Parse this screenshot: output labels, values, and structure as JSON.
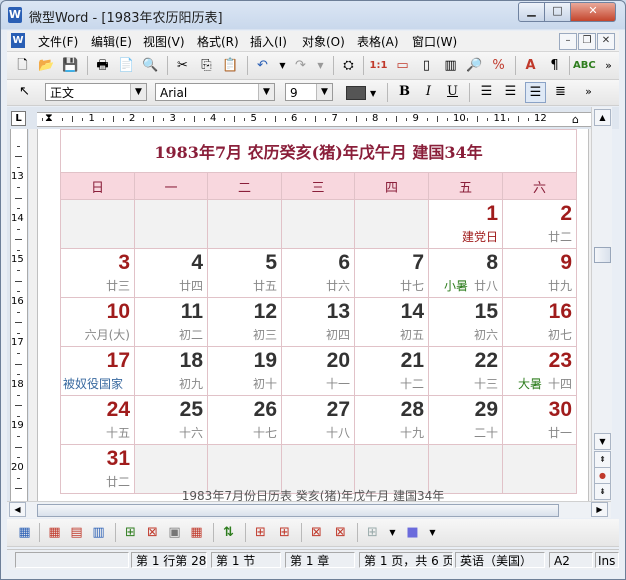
{
  "window": {
    "title": "微型Word - [1983年农历阳历表]",
    "icon_letter": "W",
    "min_label": "▁",
    "max_label": "□",
    "close_label": "✕"
  },
  "menubar": {
    "icon_letter": "W",
    "items": [
      "文件(F)",
      "编辑(E)",
      "视图(V)",
      "格式(R)",
      "插入(I)",
      "对象(O)",
      "表格(A)",
      "窗口(W)"
    ],
    "mdi_min": "–",
    "mdi_restore": "❐",
    "mdi_close": "✕"
  },
  "format_toolbar": {
    "style": "正文",
    "font": "Arial",
    "size": "9",
    "bold": "B",
    "italic": "I",
    "underline": "U"
  },
  "ruler": {
    "corner": "L",
    "numbers": [
      "1",
      "2",
      "3",
      "4",
      "5",
      "6",
      "7",
      "8",
      "9",
      "10",
      "11",
      "12"
    ]
  },
  "vruler": {
    "numbers": [
      "13",
      "14",
      "15",
      "16",
      "17",
      "18",
      "19",
      "20"
    ]
  },
  "calendar": {
    "heading": "1983年7月  农历癸亥(猪)年戊午月  建国34年",
    "weekdays": [
      "日",
      "一",
      "二",
      "三",
      "四",
      "五",
      "六"
    ],
    "weeks": [
      [
        null,
        null,
        null,
        null,
        null,
        {
          "d": "1",
          "l": "建党日",
          "h": ""
        },
        {
          "d": "2",
          "l": "廿二",
          "h": ""
        }
      ],
      [
        {
          "d": "3",
          "l": "廿三",
          "h": ""
        },
        {
          "d": "4",
          "l": "廿四",
          "h": ""
        },
        {
          "d": "5",
          "l": "廿五",
          "h": ""
        },
        {
          "d": "6",
          "l": "廿六",
          "h": ""
        },
        {
          "d": "7",
          "l": "廿七",
          "h": ""
        },
        {
          "d": "8",
          "l": "廿八",
          "h": "小暑"
        },
        {
          "d": "9",
          "l": "廿九",
          "h": ""
        }
      ],
      [
        {
          "d": "10",
          "l": "六月(大)",
          "h": ""
        },
        {
          "d": "11",
          "l": "初二",
          "h": ""
        },
        {
          "d": "12",
          "l": "初三",
          "h": ""
        },
        {
          "d": "13",
          "l": "初四",
          "h": ""
        },
        {
          "d": "14",
          "l": "初五",
          "h": ""
        },
        {
          "d": "15",
          "l": "初六",
          "h": ""
        },
        {
          "d": "16",
          "l": "初七",
          "h": ""
        }
      ],
      [
        {
          "d": "17",
          "l": "",
          "h": "被奴役国家"
        },
        {
          "d": "18",
          "l": "初九",
          "h": ""
        },
        {
          "d": "19",
          "l": "初十",
          "h": ""
        },
        {
          "d": "20",
          "l": "十一",
          "h": ""
        },
        {
          "d": "21",
          "l": "十二",
          "h": ""
        },
        {
          "d": "22",
          "l": "十三",
          "h": ""
        },
        {
          "d": "23",
          "l": "十四",
          "h": "大暑"
        }
      ],
      [
        {
          "d": "24",
          "l": "十五",
          "h": ""
        },
        {
          "d": "25",
          "l": "十六",
          "h": ""
        },
        {
          "d": "26",
          "l": "十七",
          "h": ""
        },
        {
          "d": "27",
          "l": "十八",
          "h": ""
        },
        {
          "d": "28",
          "l": "十九",
          "h": ""
        },
        {
          "d": "29",
          "l": "二十",
          "h": ""
        },
        {
          "d": "30",
          "l": "廿一",
          "h": ""
        }
      ],
      [
        {
          "d": "31",
          "l": "廿二",
          "h": ""
        },
        null,
        null,
        null,
        null,
        null,
        null
      ]
    ],
    "caption": "1983年7月份日历表 癸亥(猪)年戊午月 建国34年"
  },
  "colors": {
    "heading": "#8a1f3a",
    "weekday_bg": "#f8d7de",
    "sunday_red": "#a01c1c",
    "holiday_red": "#a01c1c",
    "solar_term_green": "#2e7d1e",
    "foreign_blue": "#3a6aa0"
  },
  "statusbar": {
    "line_col": "第 1 行第 28",
    "section": "第 1 节",
    "chapter": "第 1 章",
    "pages": "第 1 页，共 6 页",
    "lang": "英语（美国）",
    "cell": "A2",
    "mode": "Ins"
  }
}
